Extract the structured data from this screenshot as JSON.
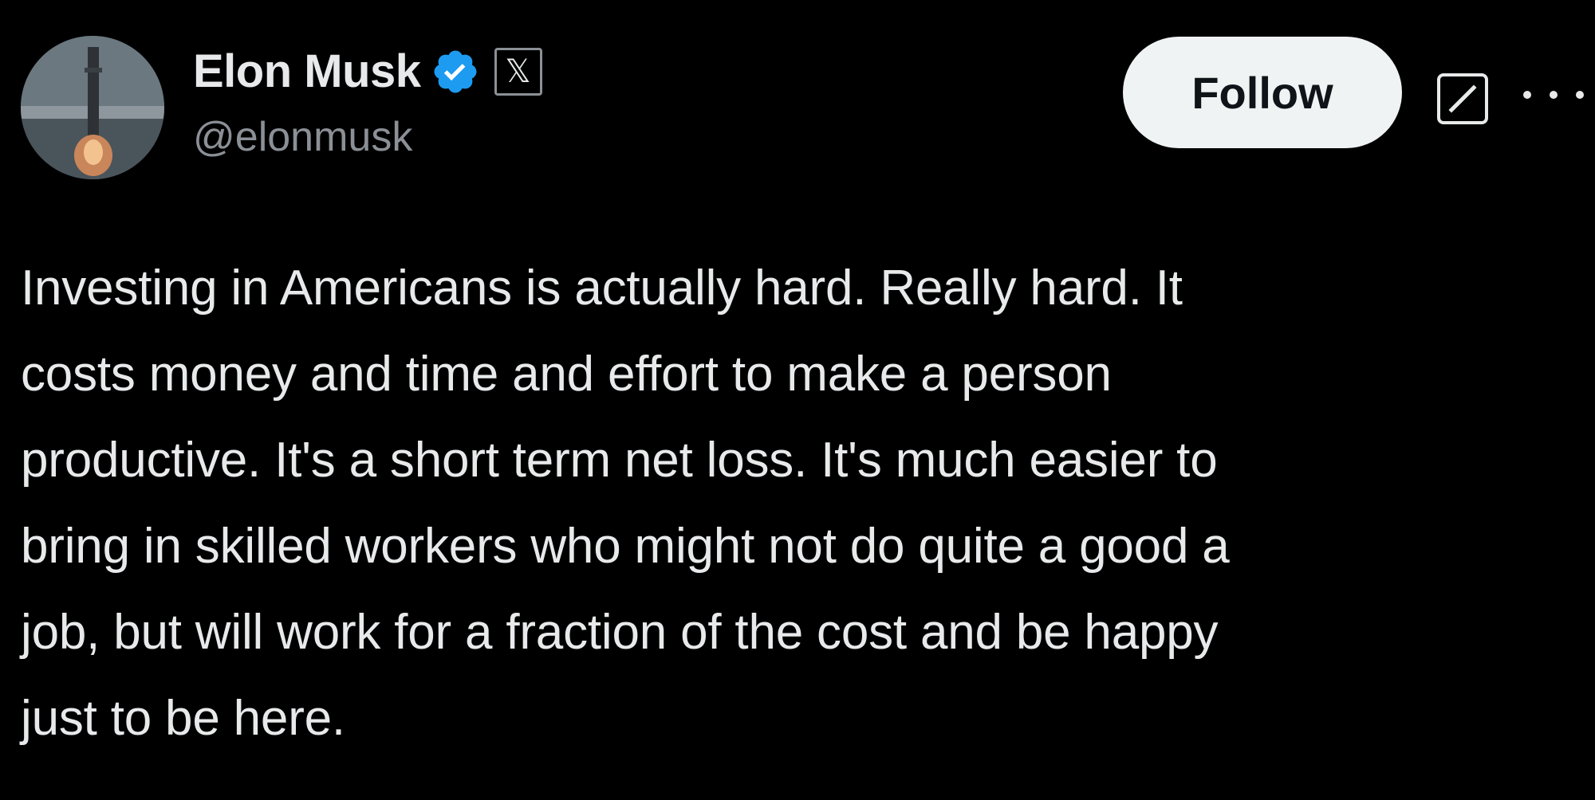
{
  "author": {
    "display_name": "Elon Musk",
    "handle": "@elonmusk",
    "verified": true,
    "verified_icon": "verified-badge-icon",
    "affiliate_badge": "𝕏"
  },
  "actions": {
    "follow_label": "Follow",
    "grok_icon": "grok-icon",
    "more_icon": "more-options-icon"
  },
  "tweet": {
    "lines": [
      "Investing in Americans is actually hard. Really hard. It",
      "costs money and time and effort to make a person",
      "productive. It's a short term net loss. It's much easier to",
      "bring in skilled workers who might not do quite a good a",
      "job, but will work for a fraction of the cost and be happy",
      "just to be here."
    ]
  },
  "colors": {
    "background": "#000000",
    "text_primary": "#e7e9ea",
    "text_secondary": "#8b9096",
    "verified_blue": "#1d9bf0",
    "follow_bg": "#eff3f4",
    "follow_text": "#0f1419"
  }
}
